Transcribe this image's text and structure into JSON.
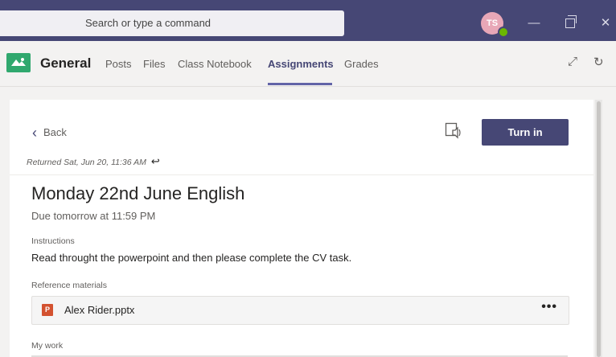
{
  "titlebar": {
    "search_placeholder": "Search or type a command",
    "avatar_initials": "TS",
    "presence_status": "available",
    "window_controls": {
      "minimize": "—",
      "maximize": "maximize-icon",
      "close": "✕"
    }
  },
  "channel": {
    "name": "General",
    "tabs": [
      {
        "label": "Posts",
        "active": false
      },
      {
        "label": "Files",
        "active": false
      },
      {
        "label": "Class Notebook",
        "active": false
      },
      {
        "label": "Assignments",
        "active": true
      },
      {
        "label": "Grades",
        "active": false
      }
    ],
    "expand_icon": "⤢",
    "refresh_icon": "↻"
  },
  "assignment": {
    "back_label": "Back",
    "turn_in_label": "Turn in",
    "returned_text": "Returned Sat, Jun 20, 11:36 AM",
    "returned_arrow": "↩",
    "title": "Monday 22nd June English",
    "due": "Due tomorrow at 11:59 PM",
    "instructions_label": "Instructions",
    "instructions_text": "Read throught the powerpoint and then please complete the CV task.",
    "reference_label": "Reference materials",
    "reference_file": {
      "name": "Alex Rider.pptx",
      "type": "powerpoint",
      "more": "•••"
    },
    "mywork_label": "My work"
  },
  "colors": {
    "brand": "#464775",
    "accent": "#6264a7",
    "presence_green": "#6bb700",
    "ppt_red": "#d35230"
  }
}
